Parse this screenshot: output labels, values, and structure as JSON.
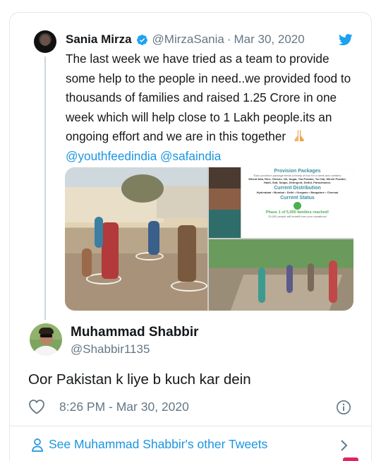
{
  "original_tweet": {
    "author_name": "Sania Mirza",
    "handle": "@MirzaSania",
    "separator": "·",
    "date": "Mar 30, 2020",
    "text_before": "The last week we have tried as a team to provide some help to the people in need..we provided food to thousands of families and raised 1.25 Crore in one week which will help close to 1 Lakh people.its an ongoing effort and we are in this together",
    "mention_1": "@youthfeedindia",
    "mention_2": "@safaindia",
    "infographic": {
      "title_1": "Provision Packages",
      "desc_1": "Each provision package feeds a family of four for a week and contains",
      "items": "Wheat Atta, Rice, Onions, Oil, Sugar, Tea Powder, Tur Dal, Mirchi Powder, Haldi, Salt, Soaps, Detergent, Dettol, Paracetamol.",
      "title_2": "Current Distribution",
      "cities": "Hyderabad • Mumbai • Delhi • Gurgaon • Bangalore • Chennai",
      "title_3": "Current Status",
      "status": "Phase 1 of 5,000 families reached!",
      "status_sub": "25,000 people will benefit from your donations!"
    }
  },
  "reply": {
    "author_name": "Muhammad Shabbir",
    "handle": "@Shabbir1135",
    "text": "Oor Pakistan k liye b kuch kar dein",
    "timestamp": "8:26 PM - Mar 30, 2020"
  },
  "footer": {
    "link_text": "See Muhammad Shabbir's other Tweets"
  },
  "icons": [
    "verified-badge-icon",
    "twitter-bird-icon",
    "folded-hands-emoji",
    "heart-icon",
    "info-icon",
    "person-icon",
    "chevron-right-icon"
  ],
  "colors": {
    "link_blue": "#1b95e0",
    "muted_gray": "#657786",
    "text": "#14171a",
    "border": "#e1e8ed"
  }
}
